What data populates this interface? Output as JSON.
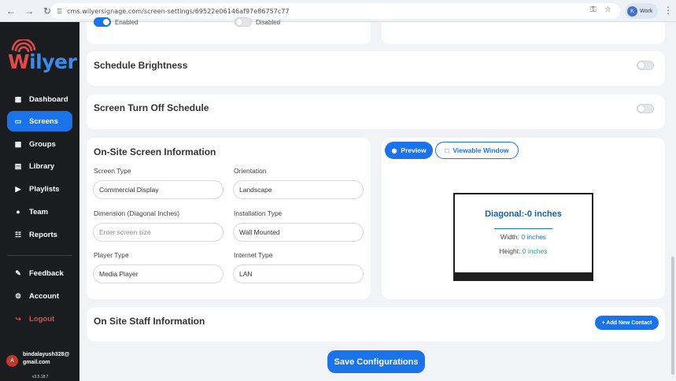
{
  "browser": {
    "url": "cms.wilyersignage.com/screen-settings/69522e06146af97e86757c77",
    "profile_initial": "K",
    "profile_label": "Work"
  },
  "brand": {
    "logo_text_prefix": "W",
    "logo_text_rest": "ilyer",
    "colors": {
      "brand_red": "#e04a47",
      "brand_blue": "#3b8bea",
      "accent": "#1a73e8"
    }
  },
  "sidebar": {
    "items": [
      {
        "label": "Dashboard",
        "icon": "dashboard-icon"
      },
      {
        "label": "Screens",
        "icon": "screen-icon",
        "active": true
      },
      {
        "label": "Groups",
        "icon": "groups-icon"
      },
      {
        "label": "Library",
        "icon": "library-icon"
      },
      {
        "label": "Playlists",
        "icon": "playlist-icon"
      },
      {
        "label": "Team",
        "icon": "team-icon"
      },
      {
        "label": "Reports",
        "icon": "reports-icon"
      }
    ],
    "bottom_items": [
      {
        "label": "Feedback",
        "icon": "feedback-icon"
      },
      {
        "label": "Account",
        "icon": "gear-icon"
      },
      {
        "label": "Logout",
        "icon": "logout-icon"
      }
    ],
    "user": {
      "initial": "A",
      "email": "bindalayush328@gmail.com"
    },
    "version": "v3.5.18.7"
  },
  "top_partial": {
    "left_toggle_label": "Enabled",
    "right_toggle_label": "Disabled"
  },
  "schedule_brightness": {
    "title": "Schedule Brightness",
    "enabled": false
  },
  "turn_off_schedule": {
    "title": "Screen Turn Off Schedule",
    "enabled": false
  },
  "onsite_info": {
    "title": "On-Site Screen Information",
    "fields": {
      "screen_type": {
        "label": "Screen Type",
        "value": "Commercial Display"
      },
      "orientation": {
        "label": "Orientation",
        "value": "Landscape"
      },
      "dimension": {
        "label": "Dimension (Diagonal Inches)",
        "value": "",
        "placeholder": "Enter screen size"
      },
      "installation_type": {
        "label": "Installation Type",
        "value": "Wall Mounted"
      },
      "player_type": {
        "label": "Player Type",
        "value": "Media Player"
      },
      "internet_type": {
        "label": "Internet Type",
        "value": "LAN"
      }
    }
  },
  "preview": {
    "preview_label": "Preview",
    "viewable_label": "Viewable Window",
    "diagonal_text": "Diagonal:-0 inches",
    "width_label": "Width:",
    "width_value": "0 inches",
    "height_label": "Height:",
    "height_value": "0 inches"
  },
  "staff": {
    "title": "On Site Staff Information",
    "add_label": "+ Add New Contact"
  },
  "save_label": "Save Configurations"
}
